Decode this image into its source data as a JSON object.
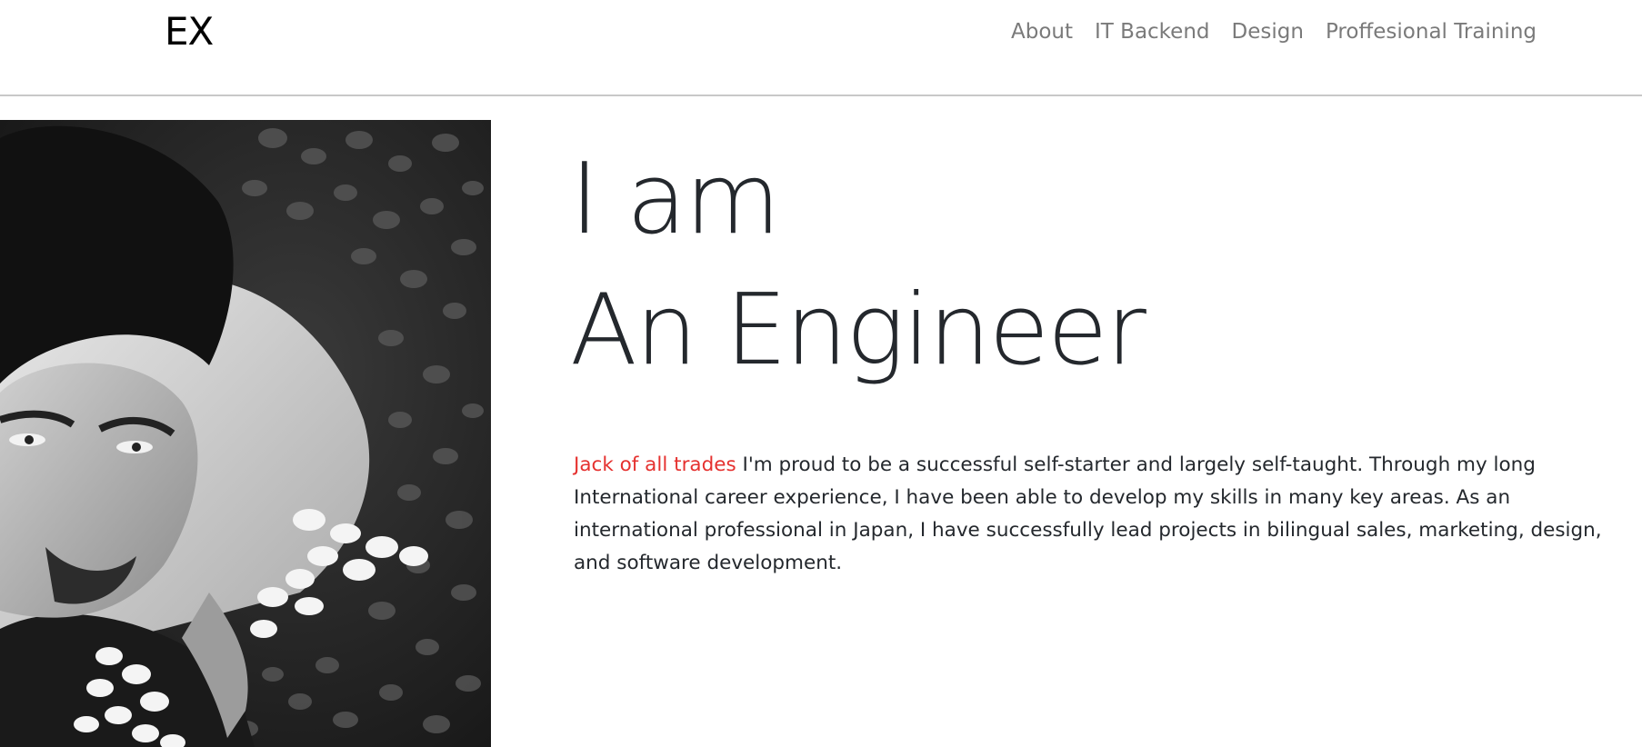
{
  "navbar": {
    "brand": "EX",
    "links": [
      {
        "label": "About"
      },
      {
        "label": "IT Backend"
      },
      {
        "label": "Design"
      },
      {
        "label": "Proffesional Training"
      }
    ]
  },
  "hero": {
    "photo_icon": "portrait-photo",
    "headline_line1": "I am",
    "headline_line2": "An Engineer",
    "intro_highlight": "Jack of all trades",
    "intro_text": " I'm proud to be a successful self-starter and largely self-taught. Through my long International career experience, I have been able to develop my skills in many key areas. As an international professional in Japan, I have successfully lead projects in bilingual sales, marketing, design, and software development."
  },
  "colors": {
    "accent": "#e5312f",
    "text": "#24282d",
    "nav_link": "#7a7a7a"
  }
}
